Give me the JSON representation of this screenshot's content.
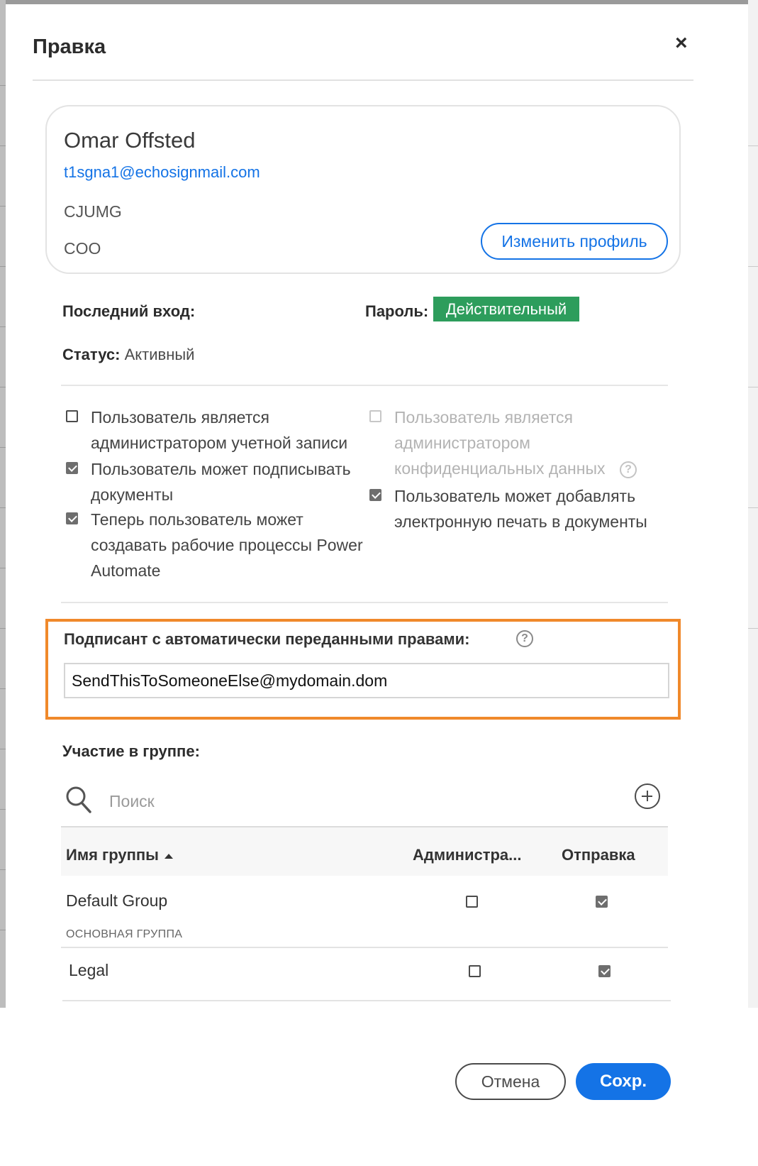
{
  "dialog": {
    "title": "Правка",
    "close_label": "×"
  },
  "profile": {
    "name": "Omar Offsted",
    "email": "t1sgna1@echosignmail.com",
    "organization": "CJUMG",
    "role": "COO",
    "edit_button": "Изменить профиль"
  },
  "account": {
    "last_login_label": "Последний вход:",
    "password_label": "Пароль:",
    "password_status": "Действительный",
    "password_status_color": "#2d9d5c",
    "status_label": "Статус:",
    "status_value": "Активный"
  },
  "permissions": {
    "left": [
      {
        "lines": [
          "Пользователь является",
          "администратором учетной записи"
        ],
        "checked": false
      },
      {
        "lines": [
          "Пользователь может подписывать",
          "документы"
        ],
        "checked": true
      },
      {
        "lines": [
          "Теперь пользователь может",
          "создавать рабочие процессы Power",
          "Automate"
        ],
        "checked": true
      }
    ],
    "right": [
      {
        "lines": [
          "Пользователь является",
          "администратором",
          "конфиденциальных данных"
        ],
        "checked": false,
        "disabled": true
      },
      {
        "lines": [
          "Пользователь может добавлять",
          "электронную печать в документы"
        ],
        "checked": true
      }
    ]
  },
  "delegate": {
    "label": "Подписант с автоматически переданными правами:",
    "value": "SendThisToSomeoneElse@mydomain.dom",
    "highlight_color": "#f0892b"
  },
  "groups": {
    "title": "Участие в группе:",
    "search_placeholder": "Поиск",
    "columns": {
      "name": "Имя группы",
      "admin": "Администра...",
      "send": "Отправка"
    },
    "rows": [
      {
        "name": "Default Group",
        "subtitle": "ОСНОВНАЯ ГРУППА",
        "admin": false,
        "send": true
      },
      {
        "name": "Legal",
        "subtitle": "",
        "admin": false,
        "send": true
      }
    ]
  },
  "footer": {
    "cancel": "Отмена",
    "save": "Сохр."
  },
  "accent_color": "#1473e6"
}
